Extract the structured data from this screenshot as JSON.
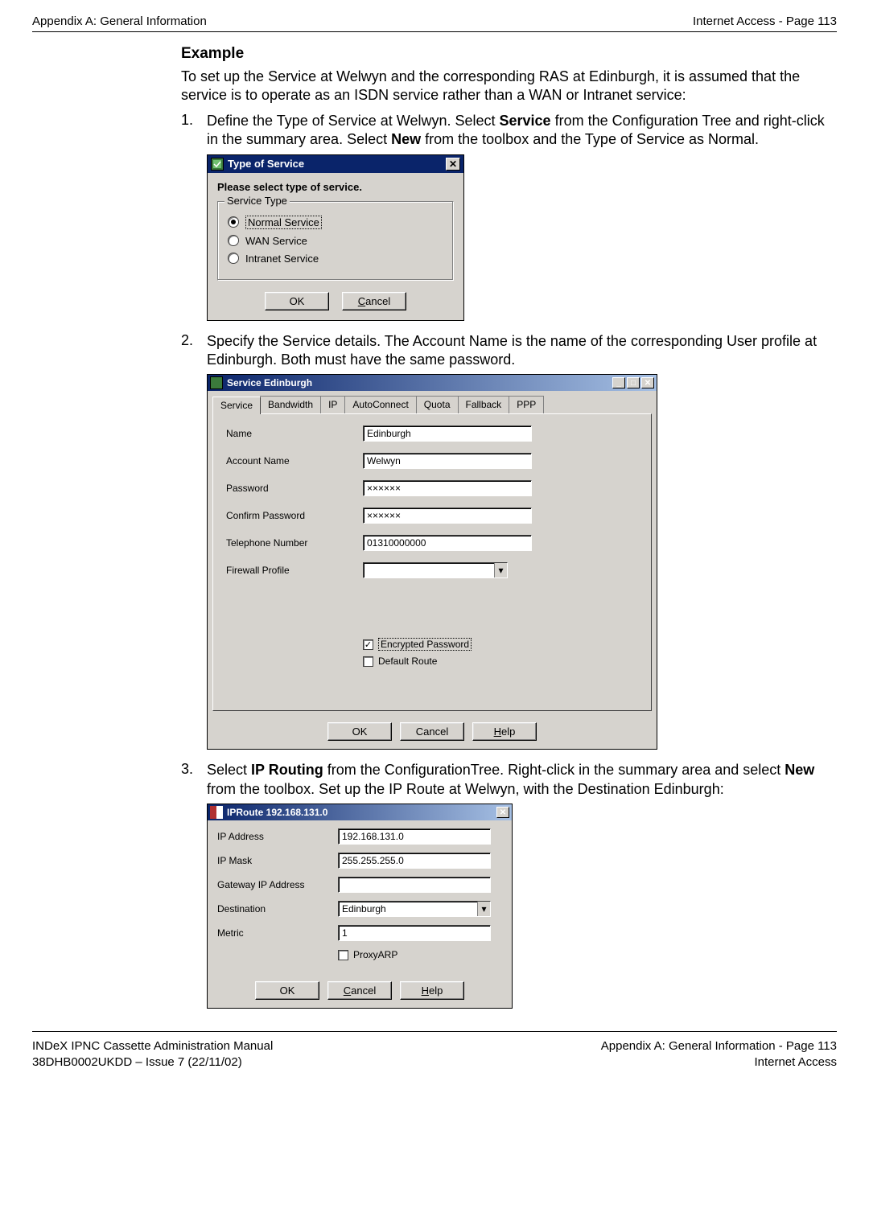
{
  "header": {
    "left": "Appendix A: General Information",
    "right": "Internet Access - Page 113"
  },
  "section_title": "Example",
  "intro_para": "To set up the Service at Welwyn and the corresponding RAS at Edinburgh, it is assumed that the service is to operate as an ISDN service rather than a WAN or Intranet service:",
  "step1": {
    "num": "1.",
    "pre": "Define the Type of Service at Welwyn. Select ",
    "bold1": "Service",
    "mid": " from the Configuration Tree and right-click in the summary area. Select ",
    "bold2": "New",
    "post": " from the toolbox and the Type of Service as Normal."
  },
  "dlg1": {
    "title": "Type of Service",
    "instr": "Please select type of service.",
    "legend": "Service Type",
    "radios": {
      "normal": "Normal Service",
      "wan": "WAN Service",
      "intranet": "Intranet Service"
    },
    "ok": "OK",
    "cancel_u": "C",
    "cancel_rest": "ancel"
  },
  "step2": {
    "num": "2.",
    "txt": "Specify the Service details. The Account Name is the name of the corresponding User profile at Edinburgh. Both must have the same password."
  },
  "dlg2": {
    "title": "Service Edinburgh",
    "tabs": [
      "Service",
      "Bandwidth",
      "IP",
      "AutoConnect",
      "Quota",
      "Fallback",
      "PPP"
    ],
    "active_tab": 0,
    "form": {
      "name_label": "Name",
      "name_val": "Edinburgh",
      "acct_label": "Account Name",
      "acct_val": "Welwyn",
      "pwd_label": "Password",
      "pwd_val": "××××××",
      "cpwd_label": "Confirm Password",
      "cpwd_val": "××××××",
      "tel_label": "Telephone Number",
      "tel_val": "01310000000",
      "fw_label": "Firewall Profile",
      "fw_val": ""
    },
    "checks": {
      "enc_label": "Encrypted Password",
      "enc_checked": true,
      "def_label": "Default Route",
      "def_checked": false
    },
    "btns": {
      "ok": "OK",
      "cancel": "Cancel",
      "help_u": "H",
      "help_rest": "elp"
    }
  },
  "step3": {
    "num": "3.",
    "pre": "Select ",
    "bold1": "IP Routing",
    "mid": " from the ConfigurationTree. Right-click in the summary area and select ",
    "bold2": "New",
    "post": " from the toolbox. Set up the IP Route at Welwyn, with the Destination Edinburgh:"
  },
  "dlg3": {
    "title": "IPRoute 192.168.131.0",
    "rows": {
      "ip_label": "IP Address",
      "ip_val": "192.168.131.0",
      "mask_label": "IP Mask",
      "mask_val": "255.255.255.0",
      "gw_label": "Gateway IP Address",
      "gw_val": "",
      "dest_label": "Destination",
      "dest_val": "Edinburgh",
      "metric_label": "Metric",
      "metric_val": "1",
      "proxy_label": "ProxyARP"
    },
    "btns": {
      "ok": "OK",
      "cancel_u": "C",
      "cancel_rest": "ancel",
      "help_u": "H",
      "help_rest": "elp"
    }
  },
  "footer": {
    "left1": "INDeX IPNC Cassette Administration Manual",
    "left2": "38DHB0002UKDD – Issue 7 (22/11/02)",
    "right1": "Appendix A: General Information - Page 113",
    "right2": "Internet Access"
  }
}
